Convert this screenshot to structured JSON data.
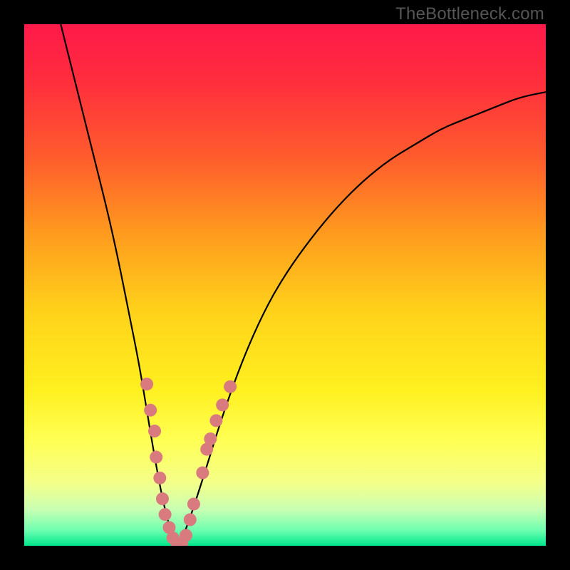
{
  "watermark": "TheBottleneck.com",
  "chart_data": {
    "type": "line",
    "title": "",
    "xlabel": "",
    "ylabel": "",
    "xlim": [
      0,
      100
    ],
    "ylim": [
      0,
      100
    ],
    "background_gradient": {
      "stops": [
        {
          "offset": 0.0,
          "color": "#ff1a49"
        },
        {
          "offset": 0.1,
          "color": "#ff2b3e"
        },
        {
          "offset": 0.25,
          "color": "#ff5a2d"
        },
        {
          "offset": 0.4,
          "color": "#ff9a1e"
        },
        {
          "offset": 0.55,
          "color": "#ffd21a"
        },
        {
          "offset": 0.7,
          "color": "#fff01f"
        },
        {
          "offset": 0.8,
          "color": "#ffff55"
        },
        {
          "offset": 0.88,
          "color": "#f4ff8a"
        },
        {
          "offset": 0.93,
          "color": "#c9ffb3"
        },
        {
          "offset": 0.97,
          "color": "#6fffb0"
        },
        {
          "offset": 1.0,
          "color": "#00e68c"
        }
      ]
    },
    "series": [
      {
        "name": "bottleneck-curve",
        "x": [
          7,
          10,
          13,
          16,
          18,
          20,
          22,
          23.5,
          25,
          26.5,
          28,
          29.5,
          31,
          34,
          38,
          42,
          46,
          50,
          55,
          60,
          65,
          70,
          75,
          80,
          85,
          90,
          95,
          100
        ],
        "y": [
          100,
          88,
          76,
          64,
          55,
          45,
          35,
          26,
          17,
          9,
          3,
          0,
          3,
          12,
          25,
          36,
          45,
          52,
          59,
          65,
          70,
          74,
          77,
          80,
          82,
          84,
          86,
          87
        ]
      }
    ],
    "markers": {
      "name": "scatter-points",
      "color": "#d97a7f",
      "radius": 9,
      "points": [
        {
          "x": 23.5,
          "y": 31
        },
        {
          "x": 24.2,
          "y": 26
        },
        {
          "x": 25.0,
          "y": 22
        },
        {
          "x": 25.3,
          "y": 17
        },
        {
          "x": 26.0,
          "y": 13
        },
        {
          "x": 26.5,
          "y": 9
        },
        {
          "x": 27.0,
          "y": 6
        },
        {
          "x": 27.8,
          "y": 3.5
        },
        {
          "x": 28.5,
          "y": 1.5
        },
        {
          "x": 29.3,
          "y": 0.5
        },
        {
          "x": 30.2,
          "y": 0.5
        },
        {
          "x": 31.0,
          "y": 2
        },
        {
          "x": 31.8,
          "y": 5
        },
        {
          "x": 32.5,
          "y": 8
        },
        {
          "x": 34.2,
          "y": 14
        },
        {
          "x": 35.0,
          "y": 18.5
        },
        {
          "x": 35.7,
          "y": 20.5
        },
        {
          "x": 36.8,
          "y": 24
        },
        {
          "x": 38.0,
          "y": 27
        },
        {
          "x": 39.5,
          "y": 30.5
        }
      ]
    }
  }
}
